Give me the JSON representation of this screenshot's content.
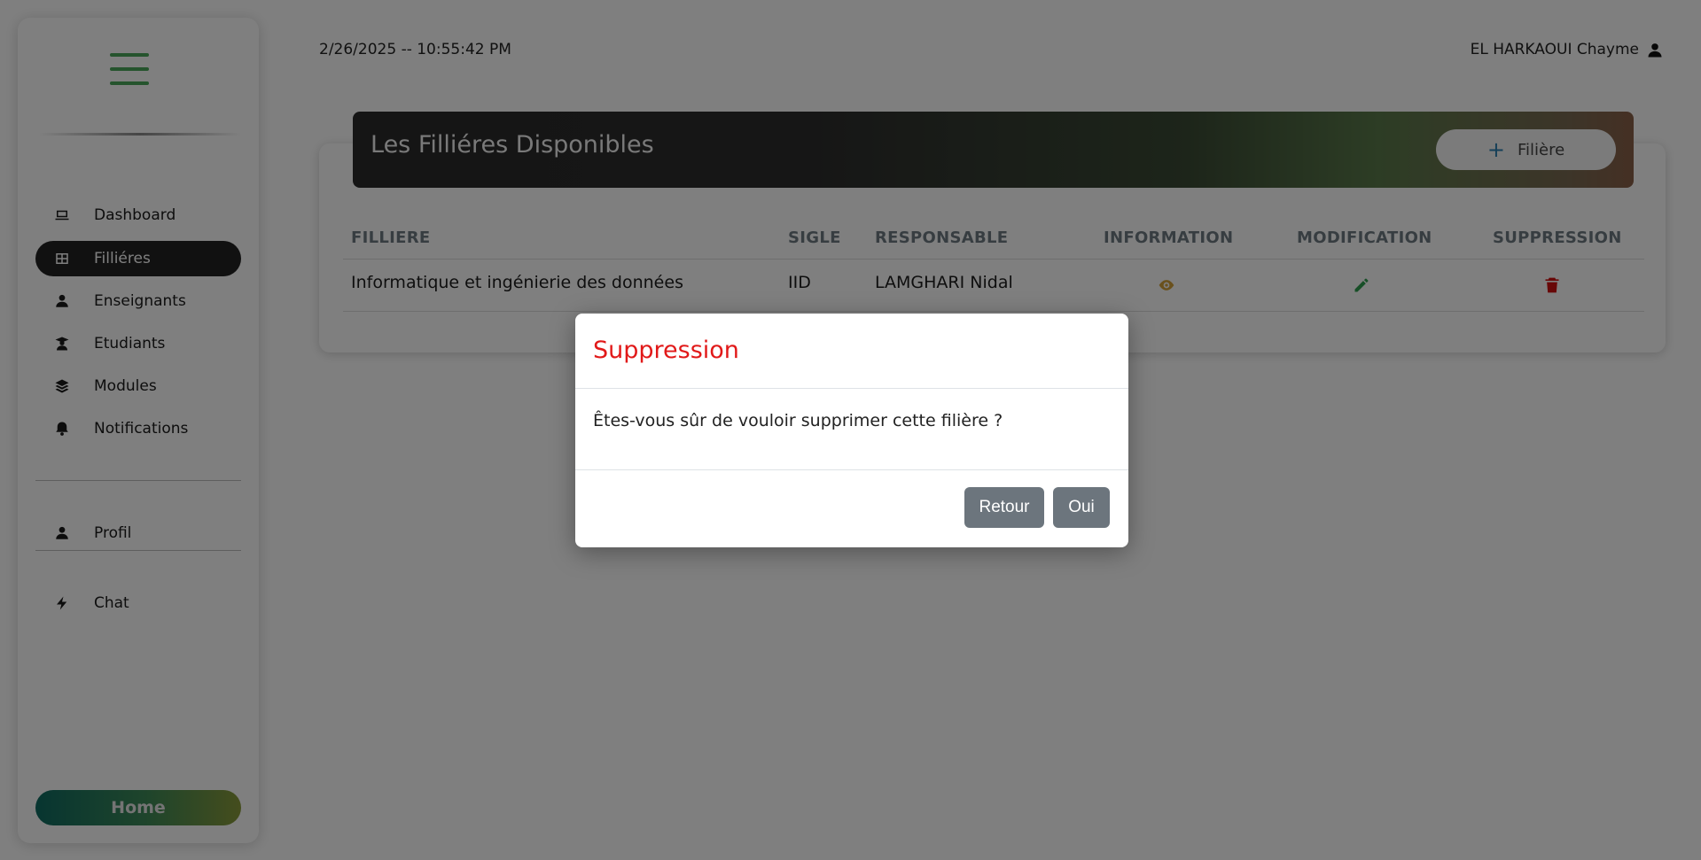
{
  "topbar": {
    "datetime": "2/26/2025 -- 10:55:42 PM",
    "user_name": "EL HARKAOUI Chayme",
    "user_icon": "user-icon"
  },
  "sidebar": {
    "menu_icon": "hamburger-icon",
    "items": [
      {
        "label": "Dashboard",
        "icon": "laptop-icon",
        "active": false
      },
      {
        "label": "Filliéres",
        "icon": "table-icon",
        "active": true
      },
      {
        "label": "Enseignants",
        "icon": "user-icon",
        "active": false
      },
      {
        "label": "Etudiants",
        "icon": "graduate-icon",
        "active": false
      },
      {
        "label": "Modules",
        "icon": "layers-icon",
        "active": false
      },
      {
        "label": "Notifications",
        "icon": "bell-icon",
        "active": false
      }
    ],
    "profile_label": "Profil",
    "chat_label": "Chat",
    "home_label": "Home"
  },
  "main": {
    "title": "Les Filliéres Disponibles",
    "add_button_label": "Filière",
    "columns": [
      "FILLIERE",
      "SIGLE",
      "RESPONSABLE",
      "INFORMATION",
      "MODIFICATION",
      "SUPPRESSION"
    ],
    "rows": [
      {
        "filiere": "Informatique et ingénierie des données",
        "sigle": "IID",
        "responsable": "LAMGHARI Nidal"
      }
    ]
  },
  "modal": {
    "title": "Suppression",
    "body": "Êtes-vous sûr de vouloir supprimer cette filière ?",
    "cancel_label": "Retour",
    "confirm_label": "Oui"
  },
  "colors": {
    "accent_green": "#4aa85a",
    "danger_red": "#e11919",
    "info_yellow": "#d4a23a",
    "edit_green": "#2e9e4f",
    "delete_red": "#d01010",
    "button_gray": "#6c757d"
  }
}
